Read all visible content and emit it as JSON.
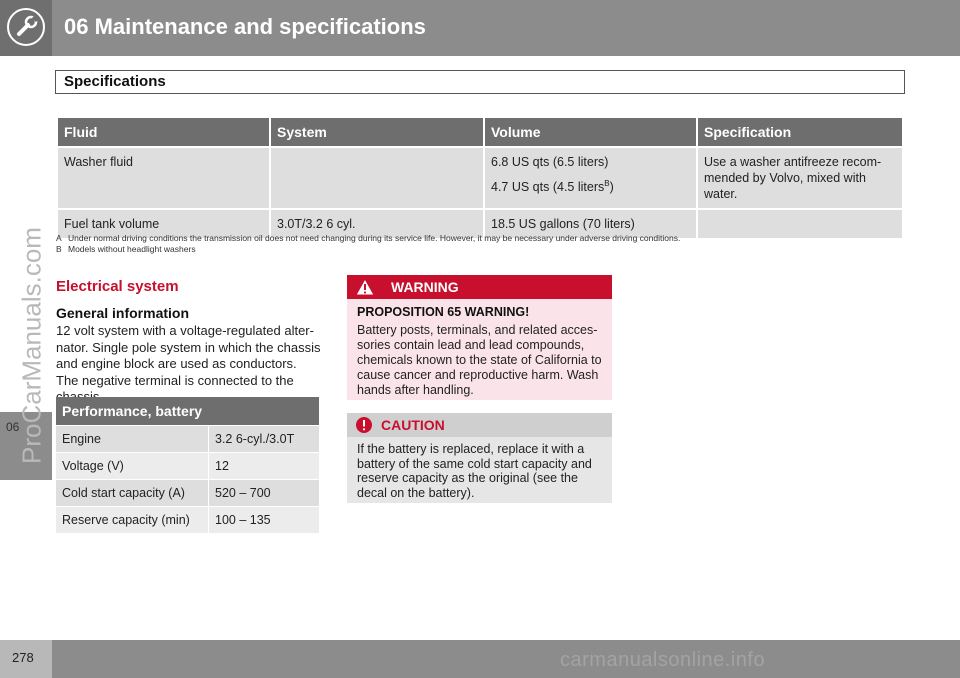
{
  "header": {
    "title": "06 Maintenance and specifications"
  },
  "side": {
    "chapter_tab": "06",
    "watermark": "ProCarManuals.com"
  },
  "section": {
    "title": "Specifications"
  },
  "fluid_table": {
    "headers": [
      "Fluid",
      "System",
      "Volume",
      "Specification"
    ],
    "row1": {
      "fluid": "Washer fluid",
      "system": "",
      "volume_line1": "6.8 US qts (6.5 liters)",
      "volume_line2": "4.7 US qts (4.5 liters",
      "volume_line2_sup": "B",
      "volume_line2_end": ")",
      "spec": "Use a washer antifreeze recom- mended by Volvo, mixed with water."
    },
    "row2": {
      "fluid": "Fuel tank volume",
      "system": "3.0T/3.2 6 cyl.",
      "volume": "18.5 US gallons (70 liters)",
      "spec": ""
    }
  },
  "footnotes": {
    "a_letter": "A",
    "a_text": "Under normal driving conditions the transmission oil does not need changing during its service life. However, it may be necessary under adverse driving conditions.",
    "b_letter": "B",
    "b_text": "Models without headlight washers"
  },
  "electrical": {
    "title": "Electrical system",
    "general_title": "General information",
    "general_text": "12 volt system with a voltage-regulated alter- nator. Single pole system in which the chassis and engine block are used as conductors. The negative terminal is connected to the chassis."
  },
  "battery_table": {
    "title": "Performance, battery",
    "rows": [
      {
        "label": "Engine",
        "value": "3.2 6-cyl./3.0T"
      },
      {
        "label": "Voltage (V)",
        "value": "12"
      },
      {
        "label": "Cold start capacity (A)",
        "value": "520 – 700"
      },
      {
        "label": "Reserve capacity (min)",
        "value": "100 – 135"
      }
    ]
  },
  "warning": {
    "label": "WARNING",
    "subtitle": "PROPOSITION 65 WARNING!",
    "text": "Battery posts, terminals, and related acces- sories contain lead and lead compounds, chemicals known to the state of California to cause cancer and reproductive harm. Wash hands after handling."
  },
  "caution": {
    "label": "CAUTION",
    "text": "If the battery is replaced, replace it with a battery of the same cold start capacity and reserve capacity as the original (see the decal on the battery)."
  },
  "footer": {
    "page_number": "278",
    "watermark": "carmanualsonline.info"
  },
  "colors": {
    "header_gray": "#8c8c8c",
    "table_header": "#6e6e6e",
    "accent_red": "#c8102e",
    "warning_bg": "#fbe3ea"
  }
}
